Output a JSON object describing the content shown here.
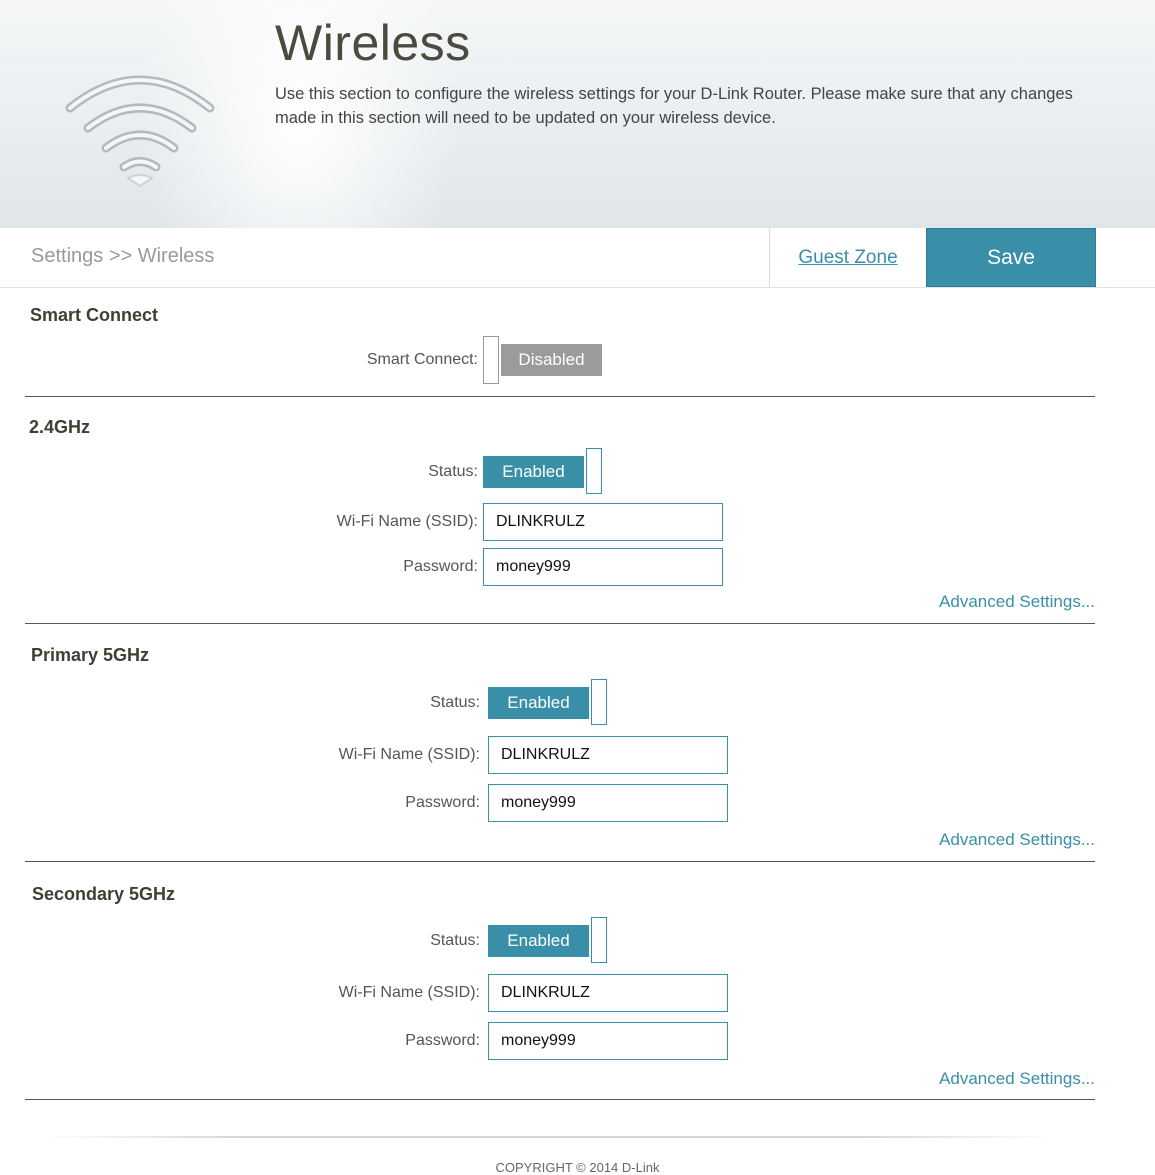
{
  "header": {
    "title": "Wireless",
    "description": "Use this section to configure the wireless settings for your D-Link Router. Please make sure that any changes made in this section will need to be updated on your wireless device.",
    "icon": "wifi-icon"
  },
  "nav": {
    "breadcrumb": "Settings >> Wireless",
    "guest_zone": "Guest Zone",
    "save": "Save"
  },
  "smart_connect": {
    "title": "Smart Connect",
    "label": "Smart Connect:",
    "state": "Disabled"
  },
  "band_24": {
    "title": "2.4GHz",
    "status_label": "Status:",
    "status": "Enabled",
    "ssid_label": "Wi-Fi Name (SSID):",
    "ssid": "DLINKRULZ",
    "password_label": "Password:",
    "password": "money999",
    "advanced": "Advanced Settings..."
  },
  "band_5_primary": {
    "title": "Primary 5GHz",
    "status_label": "Status:",
    "status": "Enabled",
    "ssid_label": "Wi-Fi Name (SSID):",
    "ssid": "DLINKRULZ",
    "password_label": "Password:",
    "password": "money999",
    "advanced": "Advanced Settings..."
  },
  "band_5_secondary": {
    "title": "Secondary 5GHz",
    "status_label": "Status:",
    "status": "Enabled",
    "ssid_label": "Wi-Fi Name (SSID):",
    "ssid": "DLINKRULZ",
    "password_label": "Password:",
    "password": "money999",
    "advanced": "Advanced Settings..."
  },
  "footer": {
    "copyright": "COPYRIGHT © 2014 D-Link"
  },
  "colors": {
    "accent": "#3a8fa8",
    "disabled": "#9b9b9b"
  }
}
